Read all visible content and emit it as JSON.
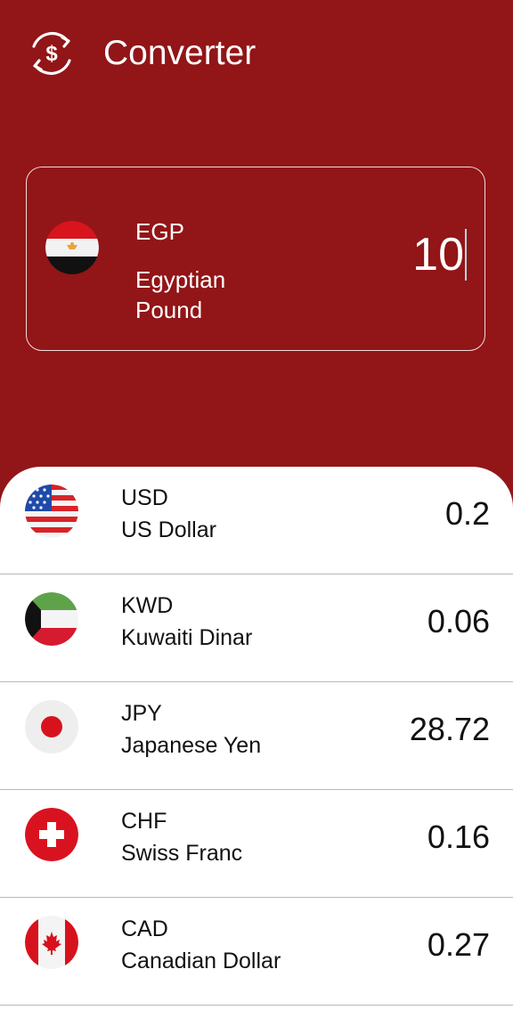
{
  "header": {
    "title": "Converter",
    "icon": "currency-exchange-icon"
  },
  "base": {
    "code": "EGP",
    "name": "Egyptian Pound",
    "amount": "10",
    "flag": "egypt-flag-icon"
  },
  "rates": [
    {
      "code": "USD",
      "name": "US Dollar",
      "value": "0.2",
      "flag": "usa-flag-icon"
    },
    {
      "code": "KWD",
      "name": "Kuwaiti Dinar",
      "value": "0.06",
      "flag": "kuwait-flag-icon"
    },
    {
      "code": "JPY",
      "name": "Japanese Yen",
      "value": "28.72",
      "flag": "japan-flag-icon"
    },
    {
      "code": "CHF",
      "name": "Swiss Franc",
      "value": "0.16",
      "flag": "switzerland-flag-icon"
    },
    {
      "code": "CAD",
      "name": "Canadian Dollar",
      "value": "0.27",
      "flag": "canada-flag-icon"
    }
  ],
  "colors": {
    "background": "#921517",
    "card_bg": "#ffffff",
    "text_light": "#ffffff",
    "text_dark": "#111111",
    "divider": "#b8b8b8"
  }
}
